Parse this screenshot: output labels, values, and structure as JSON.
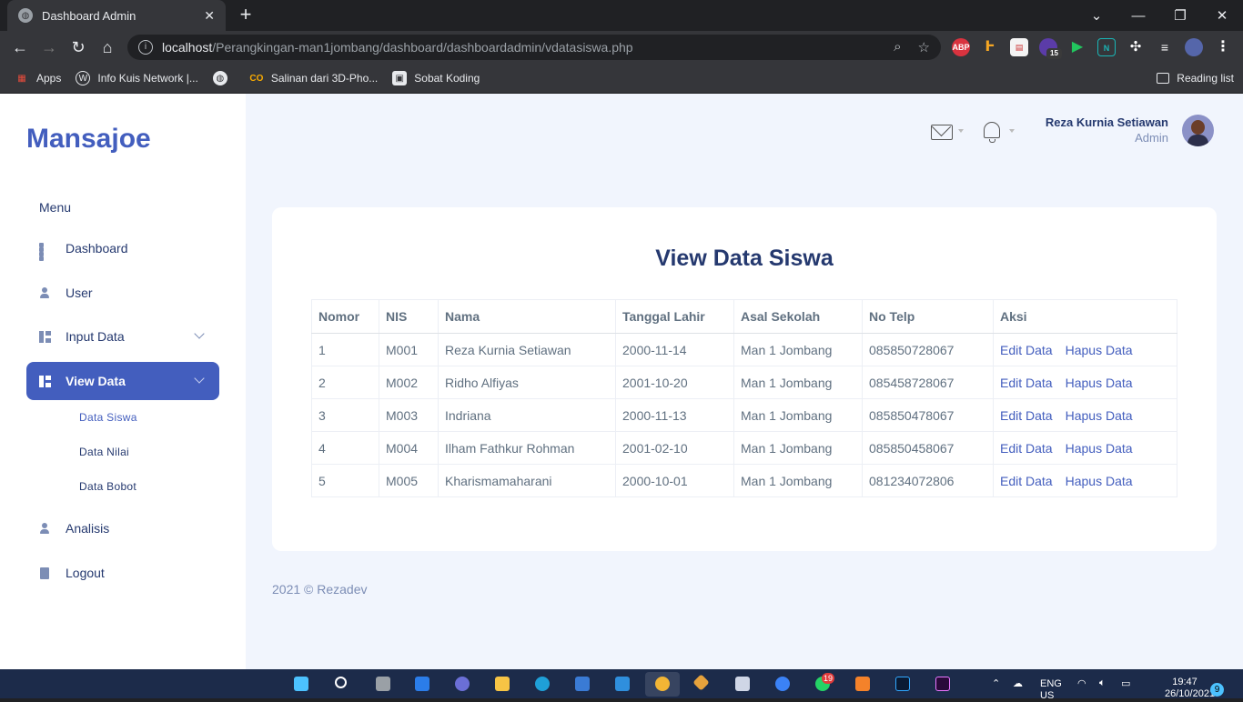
{
  "browser": {
    "tab_title": "Dashboard Admin",
    "url_host": "localhost",
    "url_path": "/Perangkingan-man1jombang/dashboard/dashboardadmin/vdatasiswa.php",
    "bookmarks": [
      {
        "label": "Apps"
      },
      {
        "label": "Info Kuis Network |..."
      },
      {
        "label": ""
      },
      {
        "label": "Salinan dari 3D-Pho..."
      },
      {
        "label": "Sobat Koding"
      }
    ],
    "reading_list": "Reading list",
    "extension_badge": "15"
  },
  "sidebar": {
    "brand": "Mansajoe",
    "menu_title": "Menu",
    "items": [
      {
        "label": "Dashboard"
      },
      {
        "label": "User"
      },
      {
        "label": "Input Data"
      },
      {
        "label": "View Data"
      },
      {
        "label": "Analisis"
      },
      {
        "label": "Logout"
      }
    ],
    "sub_items": [
      {
        "label": "Data Siswa"
      },
      {
        "label": "Data Nilai"
      },
      {
        "label": "Data Bobot"
      }
    ]
  },
  "header": {
    "user_name": "Reza Kurnia Setiawan",
    "user_role": "Admin"
  },
  "main": {
    "title": "View Data Siswa",
    "columns": [
      "Nomor",
      "NIS",
      "Nama",
      "Tanggal Lahir",
      "Asal Sekolah",
      "No Telp",
      "Aksi"
    ],
    "rows": [
      {
        "no": "1",
        "nis": "M001",
        "nama": "Reza Kurnia Setiawan",
        "tgl": "2000-11-14",
        "sekolah": "Man 1 Jombang",
        "telp": "085850728067",
        "edit": "Edit Data",
        "hapus": "Hapus Data"
      },
      {
        "no": "2",
        "nis": "M002",
        "nama": "Ridho Alfiyas",
        "tgl": "2001-10-20",
        "sekolah": "Man 1 Jombang",
        "telp": "085458728067",
        "edit": "Edit Data",
        "hapus": "Hapus Data"
      },
      {
        "no": "3",
        "nis": "M003",
        "nama": "Indriana",
        "tgl": "2000-11-13",
        "sekolah": "Man 1 Jombang",
        "telp": "085850478067",
        "edit": "Edit Data",
        "hapus": "Hapus Data"
      },
      {
        "no": "4",
        "nis": "M004",
        "nama": "Ilham Fathkur Rohman",
        "tgl": "2001-02-10",
        "sekolah": "Man 1 Jombang",
        "telp": "085850458067",
        "edit": "Edit Data",
        "hapus": "Hapus Data"
      },
      {
        "no": "5",
        "nis": "M005",
        "nama": "Kharismamaharani",
        "tgl": "2000-10-01",
        "sekolah": "Man 1 Jombang",
        "telp": "081234072806",
        "edit": "Edit Data",
        "hapus": "Hapus Data"
      }
    ],
    "footer": "2021 © Rezadev"
  },
  "taskbar": {
    "lang": "ENG",
    "region": "US",
    "time": "19:47",
    "date": "26/10/2021",
    "notifications": "9",
    "whatsapp_badge": "19"
  },
  "colors": {
    "accent": "#435ebe",
    "heading": "#25396f",
    "page_bg": "#f1f5fd"
  }
}
